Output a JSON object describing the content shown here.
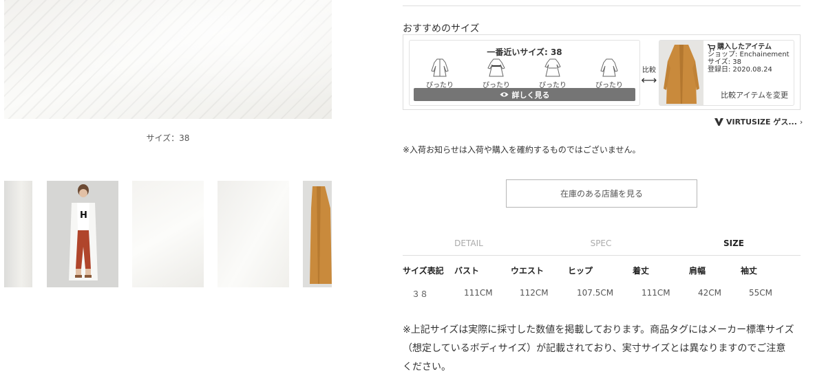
{
  "gallery": {
    "size_caption": "サイズ：38"
  },
  "recommend": {
    "heading": "おすすめのサイズ",
    "closest_size": "一番近いサイズ: 38",
    "fits": [
      "ぴったり",
      "ぴったり",
      "ぴったり",
      "ぴったり"
    ],
    "detail_button": "詳しく見る",
    "compare_label": "比較",
    "purchased": {
      "title": "購入したアイテム",
      "shop": "ショップ: Enchainement",
      "size": "サイズ: 38",
      "registered": "登録日: 2020.08.24",
      "change_link": "比較アイテムを変更"
    },
    "virtusize_label": "VIRTUSIZE ゲス...",
    "icons": [
      "eye-icon",
      "double-arrow-icon",
      "cart-icon",
      "chevron-right-icon"
    ]
  },
  "notice": "※入荷お知らせは入荷や購入を確約するものではございません。",
  "store_button": "在庫のある店舗を見る",
  "tabs": [
    "DETAIL",
    "SPEC",
    "SIZE"
  ],
  "active_tab": "SIZE",
  "size_table": {
    "headers": [
      "サイズ表記",
      "バスト",
      "ウエスト",
      "ヒップ",
      "着丈",
      "肩幅",
      "袖丈"
    ],
    "rows": [
      [
        "３８",
        "111CM",
        "112CM",
        "107.5CM",
        "111CM",
        "42CM",
        "55CM"
      ]
    ]
  },
  "size_note": "※上記サイズは実際に採寸した数値を掲載しております。商品タグにはメーカー標準サイズ（想定しているボディサイズ）が記載されており、実寸サイズとは異なりますのでご注意ください。"
}
